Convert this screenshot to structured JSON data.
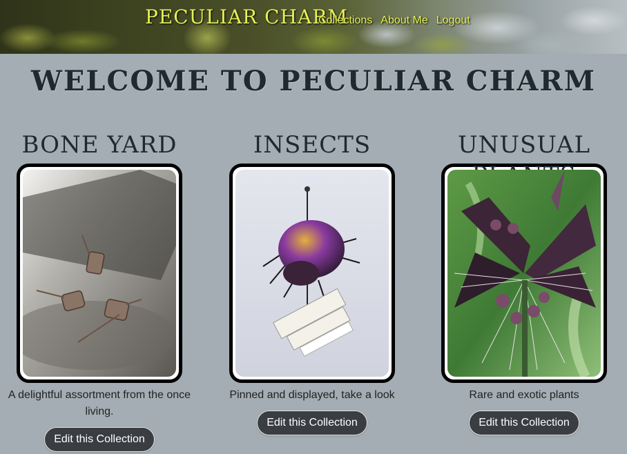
{
  "header": {
    "brand": "PECULIAR CHARM",
    "nav": [
      "Collections",
      "About Me",
      "Logout"
    ]
  },
  "welcome": "WELCOME TO PECULIAR CHARM",
  "collections": [
    {
      "title": "BONE YARD",
      "description": "A delightful assortment from the once living.",
      "button": "Edit this Collection"
    },
    {
      "title": "INSECTS",
      "description": "Pinned and displayed, take a look",
      "button": "Edit this Collection"
    },
    {
      "title": "UNUSUAL PLANTS",
      "description": "Rare and exotic plants",
      "button": "Edit this Collection"
    }
  ],
  "colors": {
    "accent": "#e6f055",
    "button": "#3a3d42",
    "background": "#a3adb3"
  }
}
